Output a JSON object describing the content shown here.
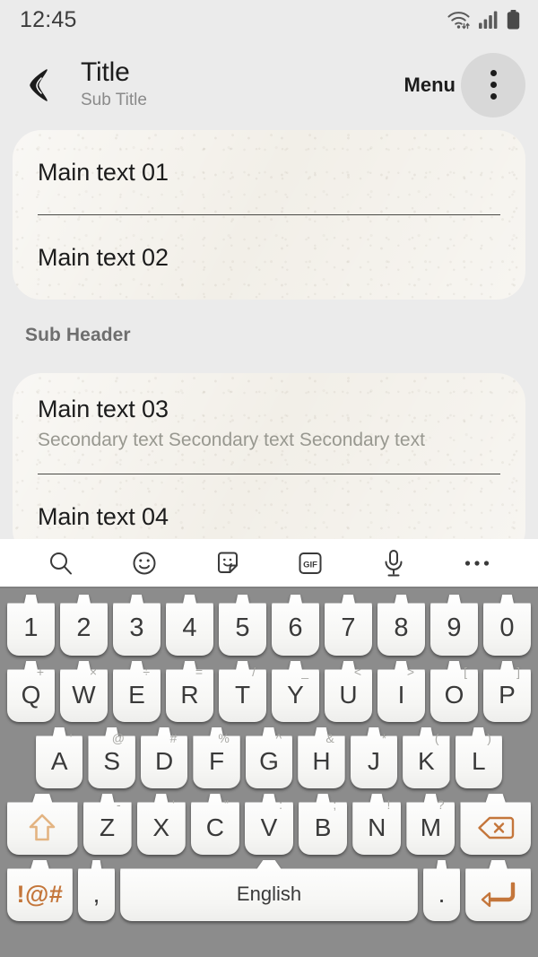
{
  "status_bar": {
    "time": "12:45",
    "icons": [
      "wifi-icon",
      "signal-icon",
      "battery-icon"
    ]
  },
  "app_bar": {
    "back_icon": "back-arrow-icon",
    "title": "Title",
    "subtitle": "Sub Title",
    "menu_label": "Menu",
    "overflow_icon": "overflow-menu-icon"
  },
  "content": {
    "group_one": [
      {
        "main": "Main text 01",
        "secondary": ""
      },
      {
        "main": "Main text 02",
        "secondary": ""
      }
    ],
    "sub_header": "Sub Header",
    "group_two": [
      {
        "main": "Main text 03",
        "secondary": "Secondary text Secondary text Secondary text"
      },
      {
        "main": "Main text 04",
        "secondary": ""
      }
    ]
  },
  "keyboard": {
    "toolbar": [
      {
        "name": "search-icon",
        "label": ""
      },
      {
        "name": "emoji-icon",
        "label": ""
      },
      {
        "name": "sticker-icon",
        "label": ""
      },
      {
        "name": "gif-icon",
        "label": "GIF"
      },
      {
        "name": "microphone-icon",
        "label": ""
      },
      {
        "name": "more-options-icon",
        "label": ""
      }
    ],
    "row_numbers": [
      {
        "key": "1",
        "sup": ""
      },
      {
        "key": "2",
        "sup": ""
      },
      {
        "key": "3",
        "sup": ""
      },
      {
        "key": "4",
        "sup": ""
      },
      {
        "key": "5",
        "sup": ""
      },
      {
        "key": "6",
        "sup": ""
      },
      {
        "key": "7",
        "sup": ""
      },
      {
        "key": "8",
        "sup": ""
      },
      {
        "key": "9",
        "sup": ""
      },
      {
        "key": "0",
        "sup": ""
      }
    ],
    "row_top": [
      {
        "key": "Q",
        "sup": "+"
      },
      {
        "key": "W",
        "sup": "×"
      },
      {
        "key": "E",
        "sup": "÷"
      },
      {
        "key": "R",
        "sup": "="
      },
      {
        "key": "T",
        "sup": "/"
      },
      {
        "key": "Y",
        "sup": "_"
      },
      {
        "key": "U",
        "sup": "<"
      },
      {
        "key": "I",
        "sup": ">"
      },
      {
        "key": "O",
        "sup": "["
      },
      {
        "key": "P",
        "sup": "]"
      }
    ],
    "row_home": [
      {
        "key": "A",
        "sup": "'"
      },
      {
        "key": "S",
        "sup": "@"
      },
      {
        "key": "D",
        "sup": "#"
      },
      {
        "key": "F",
        "sup": "%"
      },
      {
        "key": "G",
        "sup": "^"
      },
      {
        "key": "H",
        "sup": "&"
      },
      {
        "key": "J",
        "sup": "*"
      },
      {
        "key": "K",
        "sup": "("
      },
      {
        "key": "L",
        "sup": ")"
      }
    ],
    "row_bottom": [
      {
        "key": "Z",
        "sup": "-"
      },
      {
        "key": "X",
        "sup": "'"
      },
      {
        "key": "C",
        "sup": "\""
      },
      {
        "key": "V",
        "sup": ":"
      },
      {
        "key": "B",
        "sup": ";"
      },
      {
        "key": "N",
        "sup": "!"
      },
      {
        "key": "M",
        "sup": "?"
      }
    ],
    "shift_key": "shift-icon",
    "backspace_key": "backspace-icon",
    "symbols_key": "!@#",
    "comma_key": ",",
    "space_key": "English",
    "period_key": ".",
    "enter_key": "enter-icon"
  },
  "colors": {
    "accent_orange": "#c4763b",
    "shift_orange": "#e3b482",
    "page_background": "#ebebeb",
    "card_paper": "#f2efe8",
    "keyboard_background": "#8c8c8c",
    "key_face": "#fbfbfb",
    "text_primary": "#1c1c1c",
    "text_secondary": "#989890",
    "sub_header_text": "#6e6e6e"
  }
}
